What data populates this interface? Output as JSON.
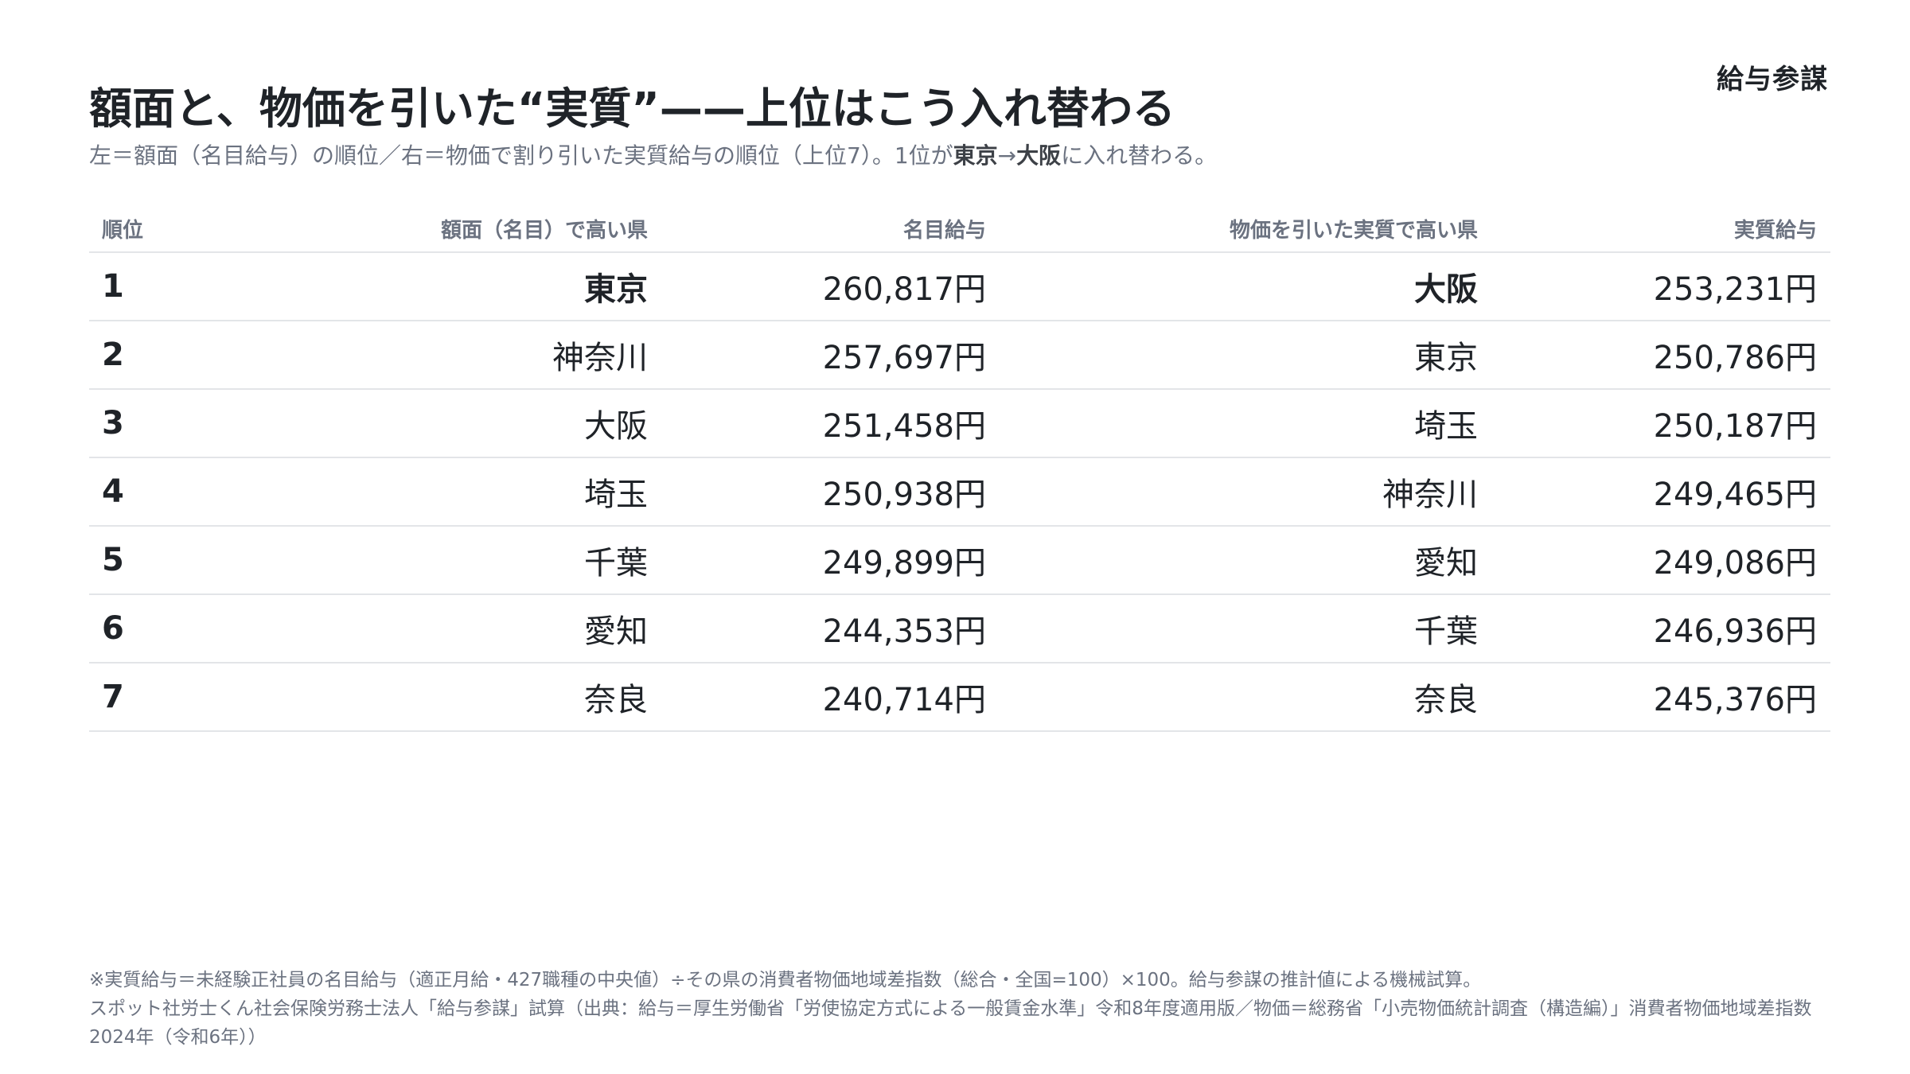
{
  "brand": "給与参謀",
  "title": "額面と、物価を引いた“実質”——上位はこう入れ替わる",
  "subtitle": {
    "part1": "左＝額面（名目給与）の順位／右＝物価で割り引いた実質給与の順位（上位7）。1位が",
    "from": "東京",
    "arrow": "→",
    "to": "大阪",
    "part2": "に入れ替わる。"
  },
  "table": {
    "headers": {
      "rank": "順位",
      "nominal_pref": "額面（名目）で高い県",
      "nominal_salary": "名目給与",
      "real_pref": "物価を引いた実質で高い県",
      "real_salary": "実質給与"
    },
    "rows": [
      {
        "rank": "1",
        "nominal_pref": "東京",
        "nominal_salary": "260,817円",
        "real_pref": "大阪",
        "real_salary": "253,231円"
      },
      {
        "rank": "2",
        "nominal_pref": "神奈川",
        "nominal_salary": "257,697円",
        "real_pref": "東京",
        "real_salary": "250,786円"
      },
      {
        "rank": "3",
        "nominal_pref": "大阪",
        "nominal_salary": "251,458円",
        "real_pref": "埼玉",
        "real_salary": "250,187円"
      },
      {
        "rank": "4",
        "nominal_pref": "埼玉",
        "nominal_salary": "250,938円",
        "real_pref": "神奈川",
        "real_salary": "249,465円"
      },
      {
        "rank": "5",
        "nominal_pref": "千葉",
        "nominal_salary": "249,899円",
        "real_pref": "愛知",
        "real_salary": "249,086円"
      },
      {
        "rank": "6",
        "nominal_pref": "愛知",
        "nominal_salary": "244,353円",
        "real_pref": "千葉",
        "real_salary": "246,936円"
      },
      {
        "rank": "7",
        "nominal_pref": "奈良",
        "nominal_salary": "240,714円",
        "real_pref": "奈良",
        "real_salary": "245,376円"
      }
    ]
  },
  "colors": {
    "accent": "#2b63d9",
    "text": "#1f2328",
    "muted": "#6b7280",
    "rule": "#e3e5e8"
  },
  "footnote": {
    "line1": "※実質給与＝未経験正社員の名目給与（適正月給・427職種の中央値）÷その県の消費者物価地域差指数（総合・全国=100）×100。給与参謀の推計値による機械試算。",
    "line2": "スポット社労士くん社会保険労務士法人「給与参謀」試算（出典：給与＝厚生労働省「労使協定方式による一般賃金水準」令和8年度適用版／物価＝総務省「小売物価統計調査（構造編）」消費者物価地域差指数",
    "line3": "2024年（令和6年））"
  }
}
